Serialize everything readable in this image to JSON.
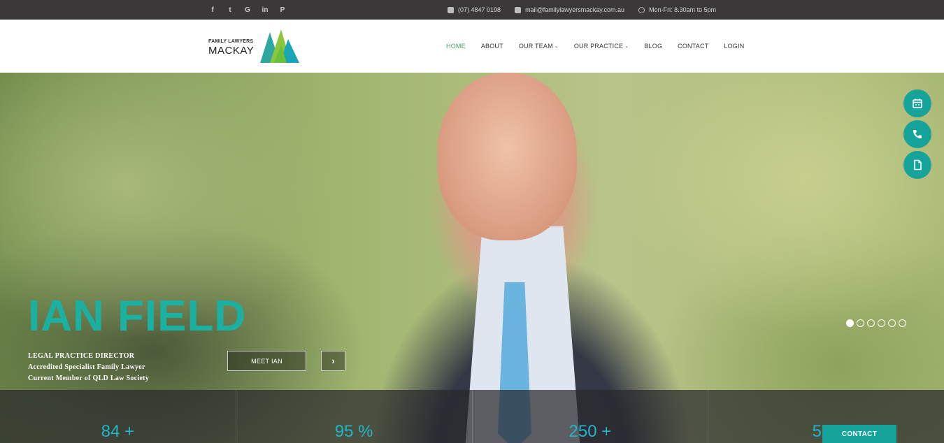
{
  "topbar": {
    "social_icons": [
      "facebook-icon",
      "twitter-icon",
      "google-icon",
      "linkedin-icon",
      "pinterest-icon"
    ],
    "social_glyphs": [
      "f",
      "t",
      "G",
      "in",
      "P"
    ],
    "phone": "(07) 4847 0198",
    "email": "mail@familylawyersmackay.com.au",
    "hours": "Mon-Fri: 8.30am to 5pm"
  },
  "header": {
    "logo_line1": "FAMILY LAWYERS",
    "logo_line2": "MACKAY",
    "nav": [
      {
        "label": "HOME",
        "active": true,
        "dropdown": false
      },
      {
        "label": "ABOUT",
        "active": false,
        "dropdown": false
      },
      {
        "label": "OUR TEAM",
        "active": false,
        "dropdown": true
      },
      {
        "label": "OUR PRACTICE",
        "active": false,
        "dropdown": true
      },
      {
        "label": "BLOG",
        "active": false,
        "dropdown": false
      },
      {
        "label": "CONTACT",
        "active": false,
        "dropdown": false
      },
      {
        "label": "LOGIN",
        "active": false,
        "dropdown": false
      }
    ]
  },
  "hero": {
    "title": "IAN FIELD",
    "role": "LEGAL PRACTICE DIRECTOR",
    "line2": "Accredited Specialist Family Lawyer",
    "line3": "Current Member of QLD Law Society",
    "cta": "MEET IAN",
    "next_glyph": "›",
    "slides": 6,
    "active_slide": 1
  },
  "floating_buttons": [
    "calendar-icon",
    "phone-icon",
    "document-icon"
  ],
  "stats": [
    "84 +",
    "95 %",
    "250 +",
    "500"
  ],
  "contact_tab": "CONTACT",
  "colors": {
    "accent": "#15a39a",
    "title": "#1ab0a2",
    "stat_number": "#21b5c6",
    "topbar": "#3a3838"
  }
}
